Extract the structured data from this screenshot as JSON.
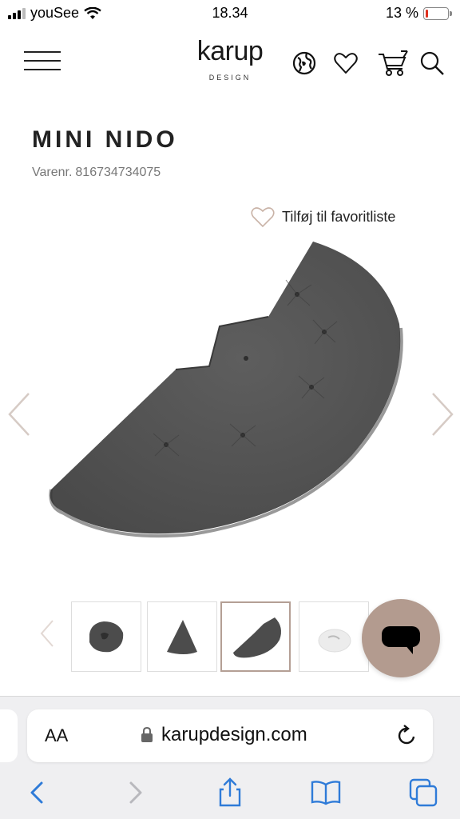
{
  "status_bar": {
    "carrier": "youSee",
    "time": "18.34",
    "battery_percent": "13 %",
    "battery_level": 0.13
  },
  "header": {
    "logo_main": "karup",
    "logo_sub": "DESIGN",
    "icons": [
      "menu-icon",
      "globe-icon",
      "heart-icon",
      "cart-icon",
      "search-icon"
    ]
  },
  "product": {
    "title": "MINI NIDO",
    "sku_label": "Varenr.",
    "sku_value": "816734734075",
    "favorite_label": "Tilføj til favoritliste",
    "color_hex": "#525252"
  },
  "thumbnails": {
    "active_index": 2,
    "items": [
      "thumb-chair-dark",
      "thumb-cone-dark",
      "thumb-halfmoon-dark",
      "thumb-light"
    ]
  },
  "browser": {
    "aa_label": "AA",
    "url": "karupdesign.com"
  },
  "colors": {
    "accent": "#b39b8f",
    "product_gray": "#525252",
    "battery_low": "#e0301e",
    "ios_blue": "#2f7bd8"
  }
}
